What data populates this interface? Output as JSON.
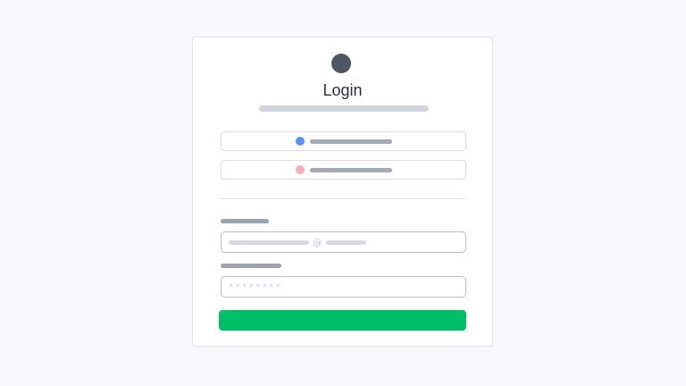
{
  "login": {
    "title": "Login",
    "password_mask": "********",
    "email_at": "@"
  },
  "colors": {
    "avatar": "#4e5565",
    "google_dot": "#5b93f5",
    "other_dot": "#f6aeb8",
    "submit": "#00bf68",
    "background": "#f7f8fa"
  },
  "icons": {
    "avatar": "logo-circle",
    "google": "circle-blue",
    "other": "circle-pink"
  }
}
